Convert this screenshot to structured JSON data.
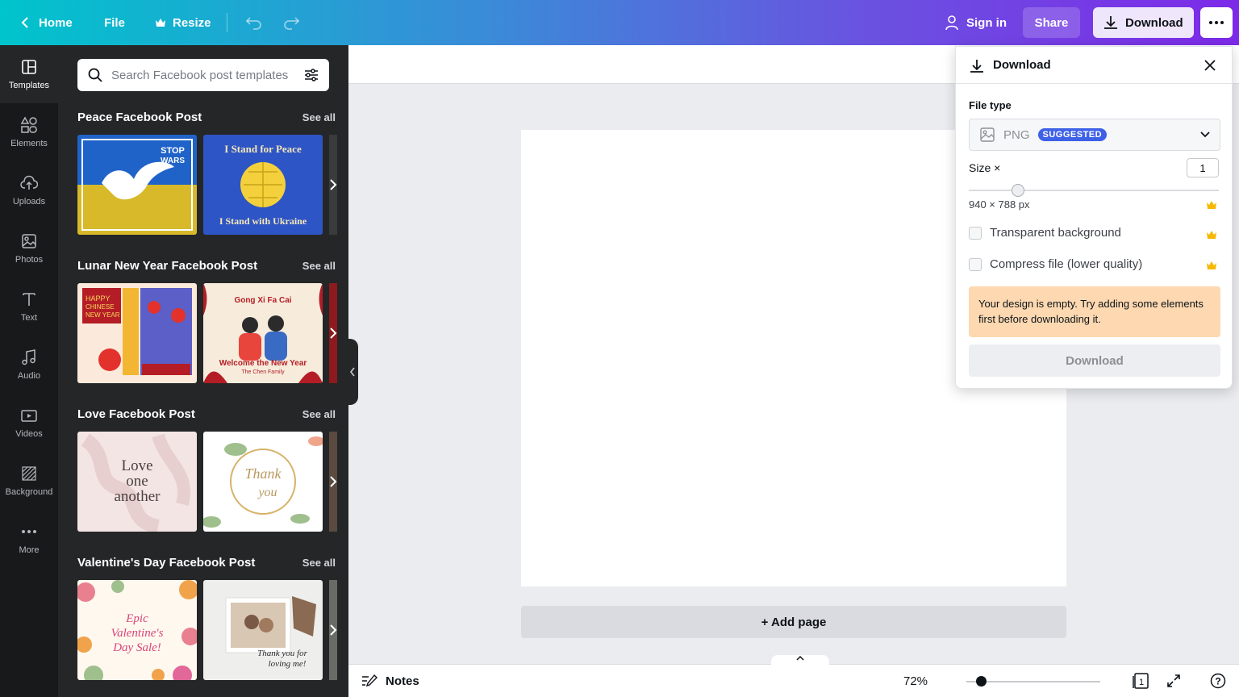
{
  "topbar": {
    "home": "Home",
    "file": "File",
    "resize": "Resize",
    "sign_in": "Sign in",
    "share": "Share",
    "download": "Download"
  },
  "rail": [
    {
      "label": "Templates",
      "icon": "templates-icon"
    },
    {
      "label": "Elements",
      "icon": "elements-icon"
    },
    {
      "label": "Uploads",
      "icon": "upload-cloud-icon"
    },
    {
      "label": "Photos",
      "icon": "image-icon"
    },
    {
      "label": "Text",
      "icon": "text-t-icon"
    },
    {
      "label": "Audio",
      "icon": "music-note-icon"
    },
    {
      "label": "Videos",
      "icon": "video-play-icon"
    },
    {
      "label": "Background",
      "icon": "background-hatch-icon"
    },
    {
      "label": "More",
      "icon": "more-dots-icon"
    }
  ],
  "search": {
    "placeholder": "Search Facebook post templates"
  },
  "sections": [
    {
      "title": "Peace Facebook Post",
      "see_all": "See all",
      "thumbs": [
        {
          "text_top": "STOP",
          "text_bottom": "WARS"
        },
        {
          "text_top": "I Stand for Peace",
          "text_bottom": "I Stand with Ukraine"
        }
      ]
    },
    {
      "title": "Lunar New Year Facebook Post",
      "see_all": "See all",
      "thumbs": [
        {
          "text_top": "HAPPY",
          "text_mid": "CHINESE",
          "text_bottom": "NEW YEAR"
        },
        {
          "text_top": "Gong Xi Fa Cai",
          "text_mid": "Welcome the New Year",
          "text_bottom": "The Chen Family"
        }
      ]
    },
    {
      "title": "Love Facebook Post",
      "see_all": "See all",
      "thumbs": [
        {
          "line1": "Love",
          "line2": "one",
          "line3": "another"
        },
        {
          "line1": "Thank",
          "line2": "you"
        }
      ]
    },
    {
      "title": "Valentine's Day Facebook Post",
      "see_all": "See all",
      "thumbs": [
        {
          "line1": "Epic",
          "line2": "Valentine's",
          "line3": "Day Sale!"
        },
        {
          "line1": "Thank you for",
          "line2": "loving me!"
        }
      ]
    }
  ],
  "canvas": {
    "add_page": "+ Add page"
  },
  "bottombar": {
    "notes": "Notes",
    "zoom": "72%",
    "page_count": "1",
    "help": "?"
  },
  "download_panel": {
    "title": "Download",
    "file_type_label": "File type",
    "file_type_value": "PNG",
    "badge": "SUGGESTED",
    "size_label": "Size ×",
    "size_value": "1",
    "dimensions": "940 × 788 px",
    "transparent_label": "Transparent background",
    "compress_label": "Compress file (lower quality)",
    "warning": "Your design is empty. Try adding some elements first before downloading it.",
    "download_button": "Download",
    "crown_color": "#f6b800"
  },
  "colors": {
    "gradient_start": "#00c4cc",
    "gradient_end": "#7d2ae8",
    "panel_bg": "#252627",
    "rail_bg": "#18191b",
    "badge": "#3e61e8",
    "warning_bg": "#fdd8b0"
  }
}
